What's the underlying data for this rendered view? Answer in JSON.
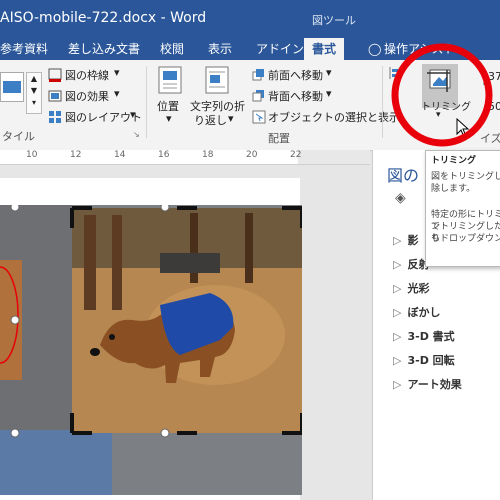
{
  "titlebar": {
    "doc_title": "AISO-mobile-722.docx - Word",
    "tool_group": "図ツール"
  },
  "tabs": [
    "参考資料",
    "差し込み文書",
    "校閲",
    "表示",
    "アドイン",
    "書式",
    "操作アシスト"
  ],
  "active_tab": "書式",
  "ribbon": {
    "style_group_label": "タイル",
    "picture_border": "図の枠線",
    "picture_effects": "図の効果",
    "picture_layout": "図のレイアウト",
    "position": "位置",
    "wrap_text_1": "文字列の折",
    "wrap_text_2": "り返し",
    "bring_forward": "前面へ移動",
    "send_backward": "背面へ移動",
    "selection_pane": "オブジェクトの選択と表示",
    "arrange_group_label": "配置",
    "crop": "トリミング",
    "size_group_label": "イズ",
    "size_value": "37",
    "size_value2": "50"
  },
  "ruler": {
    "ticks": [
      "10",
      "12",
      "14",
      "16",
      "18",
      "20",
      "22"
    ]
  },
  "tooltip": {
    "title": "トリミング",
    "line1": "図をトリミングし",
    "line2": "除します。",
    "line3": "特定の形にトリミン",
    "line4": "でトリミングしたり",
    "line5": "もドロップダウン"
  },
  "format_pane": {
    "title": "図の",
    "items": [
      "影",
      "反射",
      "光彩",
      "ぼかし",
      "3-D 書式",
      "3-D 回転",
      "アート効果"
    ]
  },
  "colors": {
    "title_bar": "#2b579a",
    "annotation_red": "#e8000b",
    "ribbon_bg": "#f3f3f3"
  }
}
